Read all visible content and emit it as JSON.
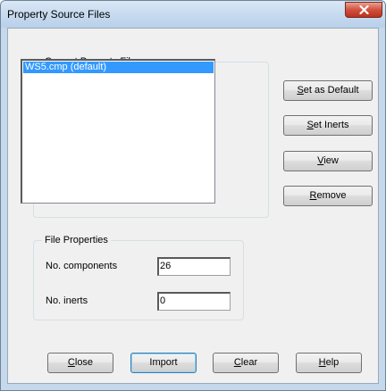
{
  "window": {
    "title": "Property Source Files",
    "close_icon": "close-icon"
  },
  "current_files": {
    "legend": "Current Property Files",
    "items": [
      "WS5.cmp (default)"
    ],
    "selected_index": 0
  },
  "side_buttons": {
    "set_default": {
      "mnemonic": "S",
      "rest": "et as Default"
    },
    "set_inerts": {
      "mnemonic": "S",
      "rest": "et Inerts"
    },
    "view": {
      "mnemonic": "V",
      "rest": "iew"
    },
    "remove": {
      "mnemonic": "R",
      "rest": "emove"
    }
  },
  "file_properties": {
    "legend": "File Properties",
    "components_label": "No. components",
    "components_value": "26",
    "inerts_label": "No. inerts",
    "inerts_value": "0"
  },
  "bottom_buttons": {
    "close": {
      "mnemonic": "C",
      "rest": "lose"
    },
    "import": {
      "label": "Import"
    },
    "clear": {
      "mnemonic": "C",
      "rest": "lear"
    },
    "help": {
      "mnemonic": "H",
      "rest": "elp"
    }
  },
  "colors": {
    "selection": "#3399ff",
    "title_bar": "#c9dcf0",
    "close_button": "#d2503c"
  }
}
